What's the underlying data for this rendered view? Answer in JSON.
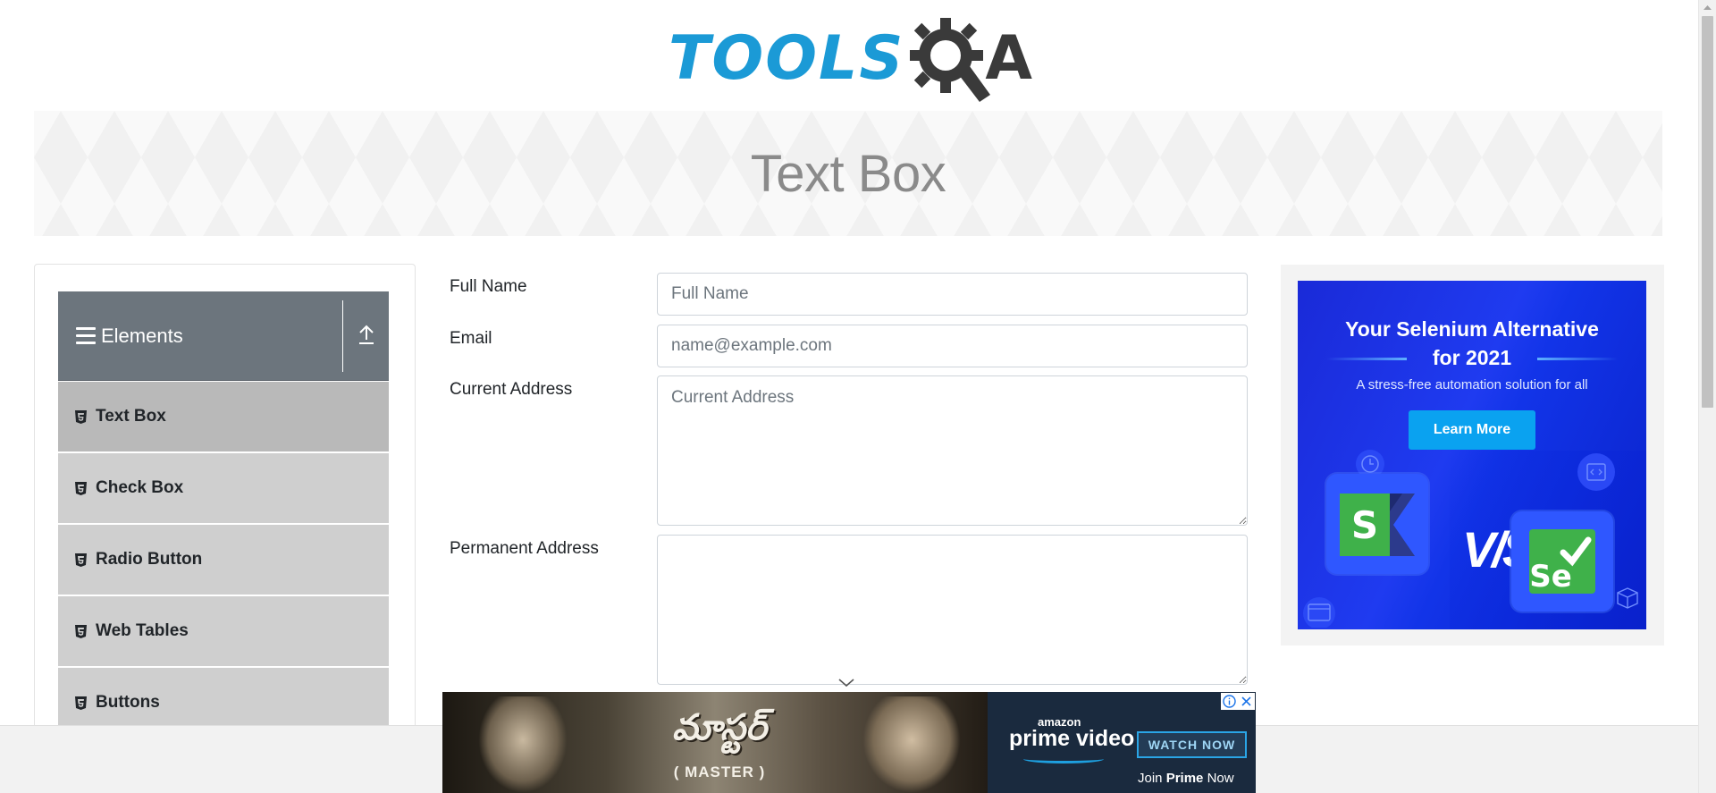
{
  "header": {
    "logo_left": "TOOLS",
    "logo_right": "A"
  },
  "banner": {
    "title": "Text Box"
  },
  "sidebar": {
    "group_label": "Elements",
    "items": [
      {
        "label": "Text Box"
      },
      {
        "label": "Check Box"
      },
      {
        "label": "Radio Button"
      },
      {
        "label": "Web Tables"
      },
      {
        "label": "Buttons"
      }
    ]
  },
  "form": {
    "full_name": {
      "label": "Full Name",
      "placeholder": "Full Name",
      "value": ""
    },
    "email": {
      "label": "Email",
      "placeholder": "name@example.com",
      "value": ""
    },
    "current_address": {
      "label": "Current Address",
      "placeholder": "Current Address",
      "value": ""
    },
    "permanent_address": {
      "label": "Permanent Address",
      "placeholder": "",
      "value": ""
    }
  },
  "right_ad": {
    "title_line1": "Your Selenium Alternative",
    "title_line2": "for 2021",
    "subtitle": "A stress-free automation solution for all",
    "button_label": "Learn More",
    "vs_text": "V/S",
    "logo_left_letter": "S",
    "logo_right_letter": "Se"
  },
  "bottom_ad": {
    "movie_title": "మాస్టర్",
    "movie_subtitle": "( MASTER )",
    "amazon_label": "amazon",
    "prime_label": "prime video",
    "watch_label": "WATCH NOW",
    "join_prefix": "Join",
    "join_bold": "Prime",
    "join_suffix": "Now"
  },
  "colors": {
    "brand_blue": "#1b9ad6",
    "sidebar_header": "#6c757d",
    "sidebar_item": "#cfcfcf",
    "sidebar_item_active": "#b9b9b9",
    "ad_blue": "#1f3bf0",
    "ad_button": "#0aa2f0"
  }
}
